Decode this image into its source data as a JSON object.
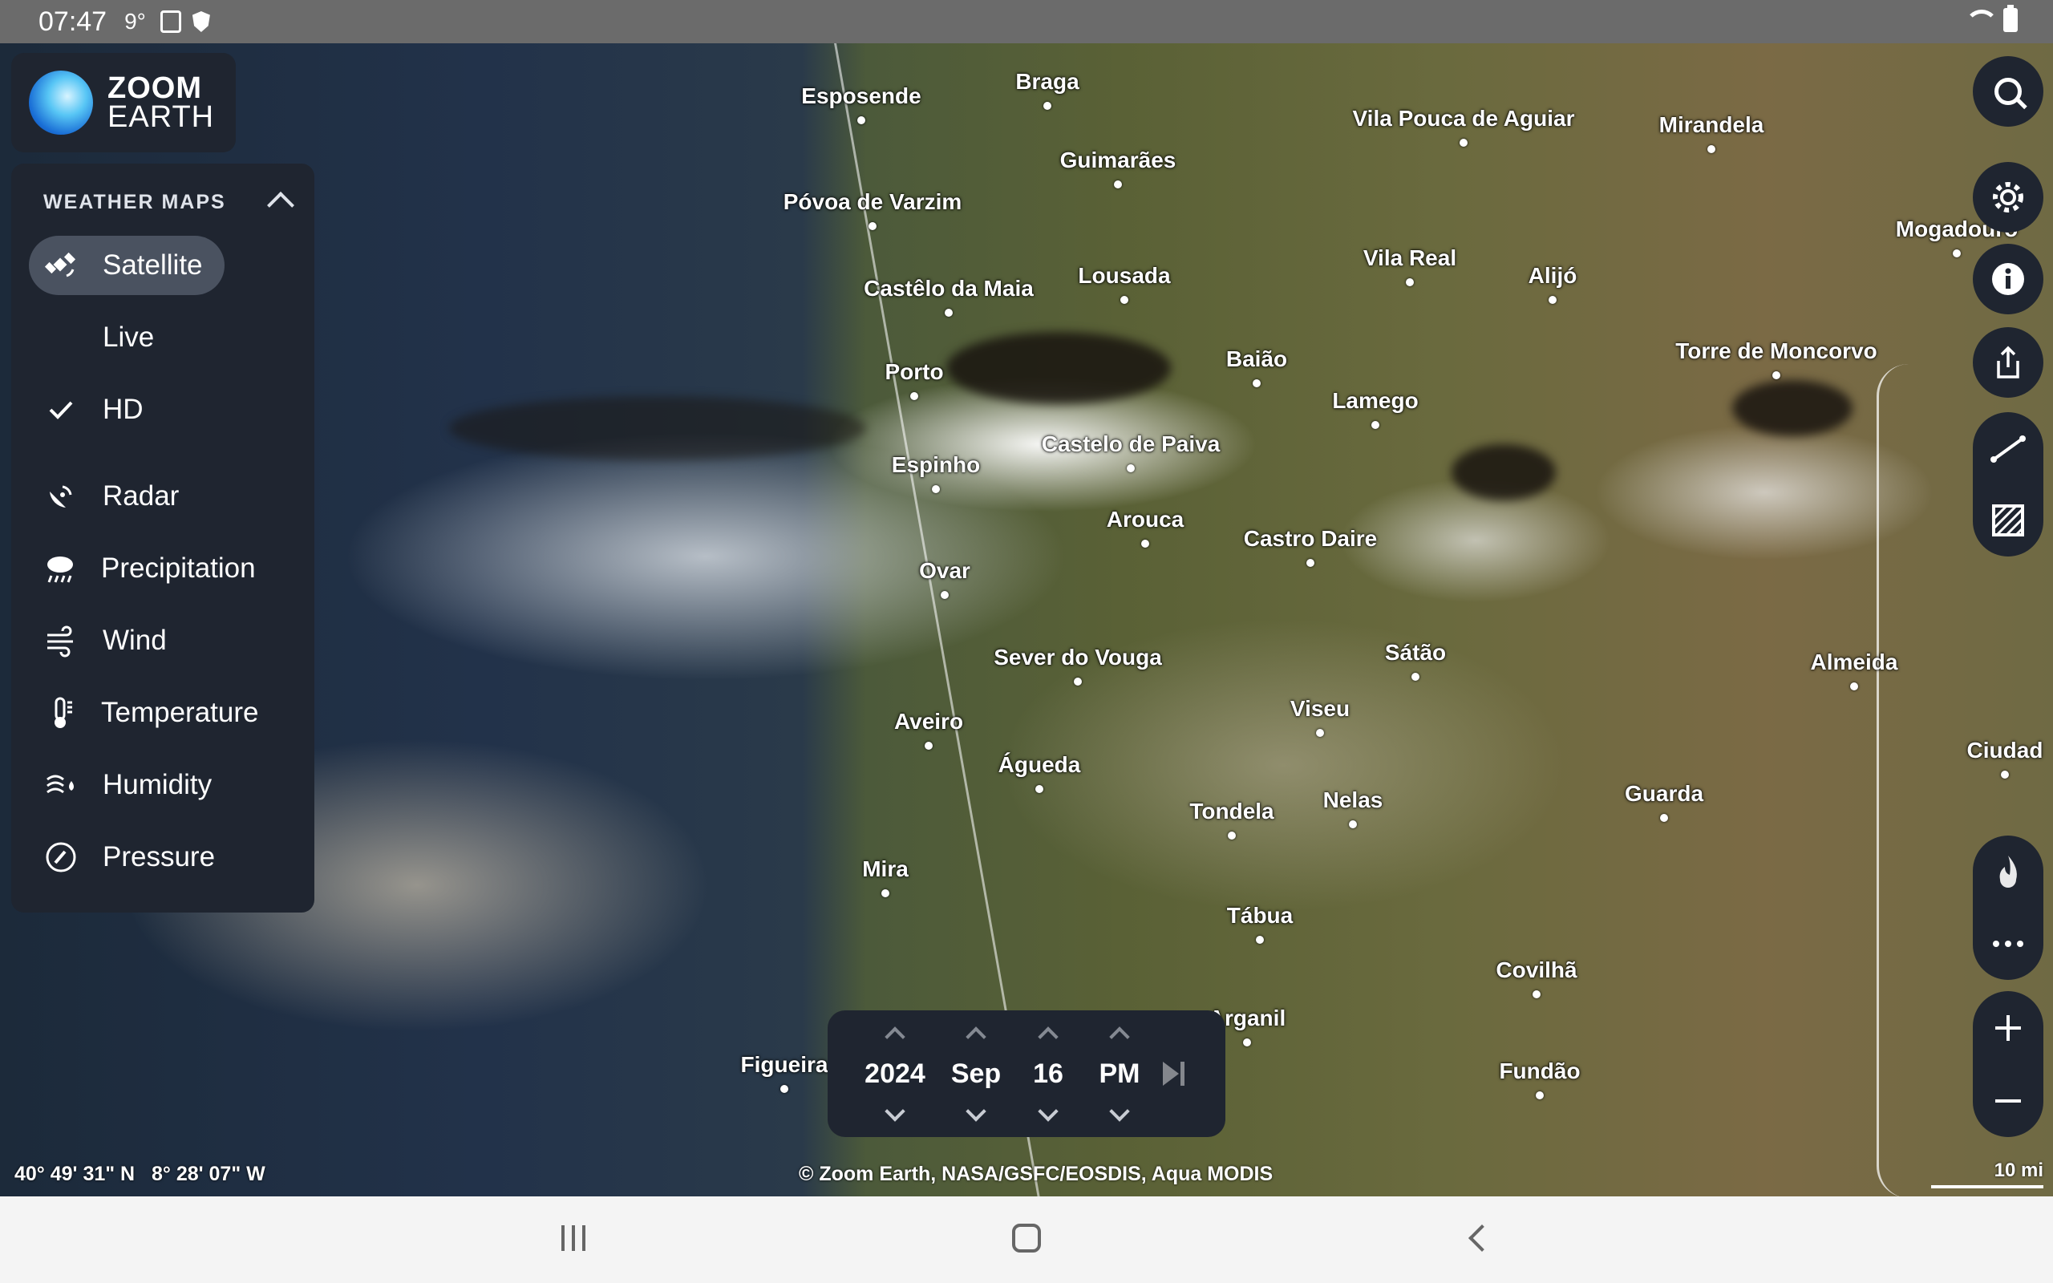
{
  "status_bar": {
    "time": "07:47",
    "temperature": "9°"
  },
  "logo": {
    "line1": "ZOOM",
    "line2": "EARTH"
  },
  "weather_panel": {
    "heading": "WEATHER MAPS",
    "items": [
      {
        "label": "Satellite",
        "icon": "satellite-icon",
        "active": true
      },
      {
        "label": "Live",
        "icon": "",
        "active": false
      },
      {
        "label": "HD",
        "icon": "checkmark-icon",
        "active": false
      },
      {
        "label": "Radar",
        "icon": "radar-icon",
        "active": false
      },
      {
        "label": "Precipitation",
        "icon": "rain-cloud-icon",
        "active": false
      },
      {
        "label": "Wind",
        "icon": "wind-icon",
        "active": false
      },
      {
        "label": "Temperature",
        "icon": "thermometer-icon",
        "active": false
      },
      {
        "label": "Humidity",
        "icon": "humidity-icon",
        "active": false
      },
      {
        "label": "Pressure",
        "icon": "pressure-gauge-icon",
        "active": false
      }
    ]
  },
  "cities": [
    "Esposende",
    "Braga",
    "Vila Pouca de Aguiar",
    "Mirandela",
    "Guimarães",
    "Póvoa de Varzim",
    "Mogadouro",
    "Vila Real",
    "Alijó",
    "Castêlo da Maia",
    "Lousada",
    "Torre de Moncorvo",
    "Baião",
    "Porto",
    "Lamego",
    "Castelo de Paiva",
    "Espinho",
    "Arouca",
    "Castro Daire",
    "Ovar",
    "Sátão",
    "Almeida",
    "Sever do Vouga",
    "Viseu",
    "Aveiro",
    "Ciudad",
    "Águeda",
    "Nelas",
    "Guarda",
    "Tondela",
    "Mira",
    "Tábua",
    "Covilhã",
    "Arganil",
    "Figueira",
    "Fundão"
  ],
  "time_picker": {
    "year": "2024",
    "month": "Sep",
    "day": "16",
    "period": "PM"
  },
  "coordinates": {
    "lat": "40° 49' 31\" N",
    "lon": "8° 28' 07\" W"
  },
  "attribution": "© Zoom Earth, NASA/GSFC/EOSDIS, Aqua MODIS",
  "scale": "10 mi",
  "right_controls": [
    "search-icon",
    "gear-icon",
    "info-icon",
    "share-icon",
    "measure-line-icon",
    "area-hatch-icon",
    "fire-icon",
    "more-dots-icon",
    "zoom-in-icon",
    "zoom-out-icon"
  ]
}
